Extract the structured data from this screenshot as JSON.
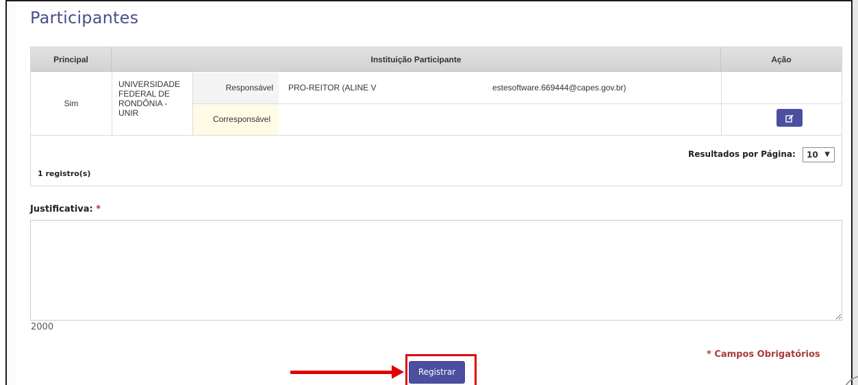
{
  "page": {
    "title": "Participantes"
  },
  "table": {
    "headers": {
      "principal": "Principal",
      "institution": "Instituição Participante",
      "action": "Ação"
    },
    "row": {
      "principal": "Sim",
      "institution_lines": [
        "UNIVERSIDADE",
        "FEDERAL DE",
        "RONDÔNIA -",
        "UNIR"
      ],
      "responsavel_label": "Responsável",
      "responsavel_name": "PRO-REITOR (ALINE V",
      "responsavel_email": "estesoftware.669444@capes.gov.br)",
      "corresponsavel_label": "Corresponsável",
      "edit_icon": "edit-icon"
    },
    "results_per_page_label": "Resultados por Página:",
    "results_per_page_value": "10",
    "record_count": "1 registro(s)"
  },
  "form": {
    "justification_label": "Justificativa:",
    "required_marker": "*",
    "justification_value": "",
    "char_counter": "2000",
    "required_note": "* Campos Obrigatórios",
    "submit_label": "Registrar"
  },
  "colors": {
    "accent": "#4c4fa0",
    "title": "#4a4f8c",
    "required": "#a93a3a",
    "annotation": "#e00000",
    "corresponsavel_bg": "#fffbe6"
  }
}
